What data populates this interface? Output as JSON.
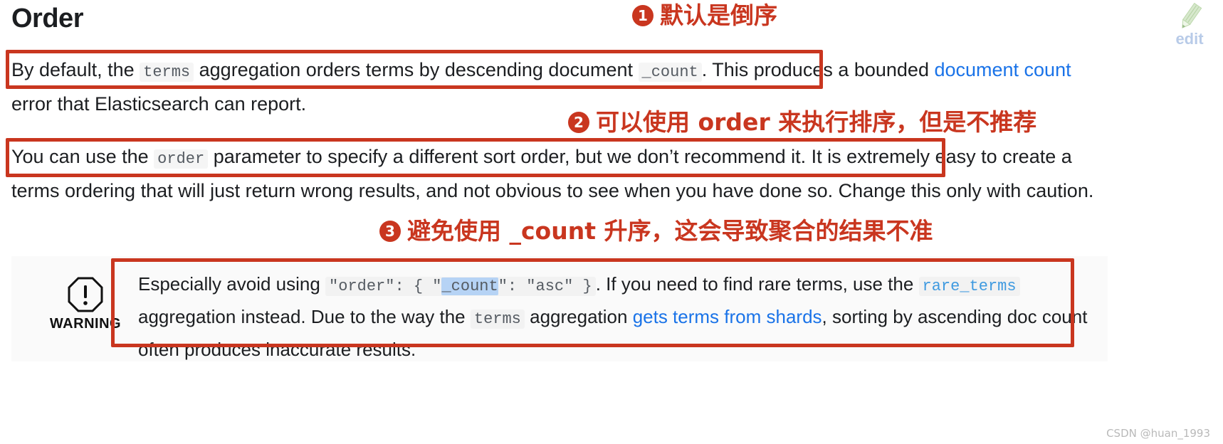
{
  "page": {
    "title": "Order",
    "watermark": "CSDN @huan_1993"
  },
  "edit": {
    "icon": "pencil-icon",
    "label": "edit"
  },
  "paragraphs": {
    "p1": {
      "seg1": "By default, the ",
      "code1": "terms",
      "seg2": " aggregation orders terms by descending document ",
      "code2": "_count",
      "seg3": ". This produces a bounded ",
      "link": "document count",
      "seg4": " error that Elasticsearch can report."
    },
    "p2": {
      "seg1": "You can use the ",
      "code1": "order",
      "seg2": " parameter to specify a different sort order, but we don’t recommend it. It is extremely easy to create a terms ordering that will just return wrong results, and not obvious to see when you have done so. Change this only with caution."
    }
  },
  "warning": {
    "icon": "warning-octagon-icon",
    "label": "WARNING",
    "seg1": "Especially avoid using ",
    "code_order": "\"order\": { \"",
    "code_count_selected": "_count",
    "code_tail": "\": \"asc\" }",
    "seg2": ". If you need to find rare terms, use the ",
    "code_rare_terms": "rare_terms",
    "seg3": " aggregation instead. Due to the way the ",
    "code_terms": "terms",
    "seg4": " aggregation ",
    "link": "gets terms from shards",
    "seg5": ", sorting by ascending doc count often produces inaccurate results."
  },
  "annotations": [
    {
      "num": "1",
      "text": "默认是倒序"
    },
    {
      "num": "2",
      "text": "可以使用 order 来执行排序，但是不推荐"
    },
    {
      "num": "3",
      "text": "避免使用 _count 升序，这会导致聚合的结果不准"
    }
  ],
  "colors": {
    "annotation_red": "#c9361f",
    "link_blue": "#1a73e8",
    "selection_blue": "#b6d3f5",
    "code_blue": "#3f9ae0"
  }
}
